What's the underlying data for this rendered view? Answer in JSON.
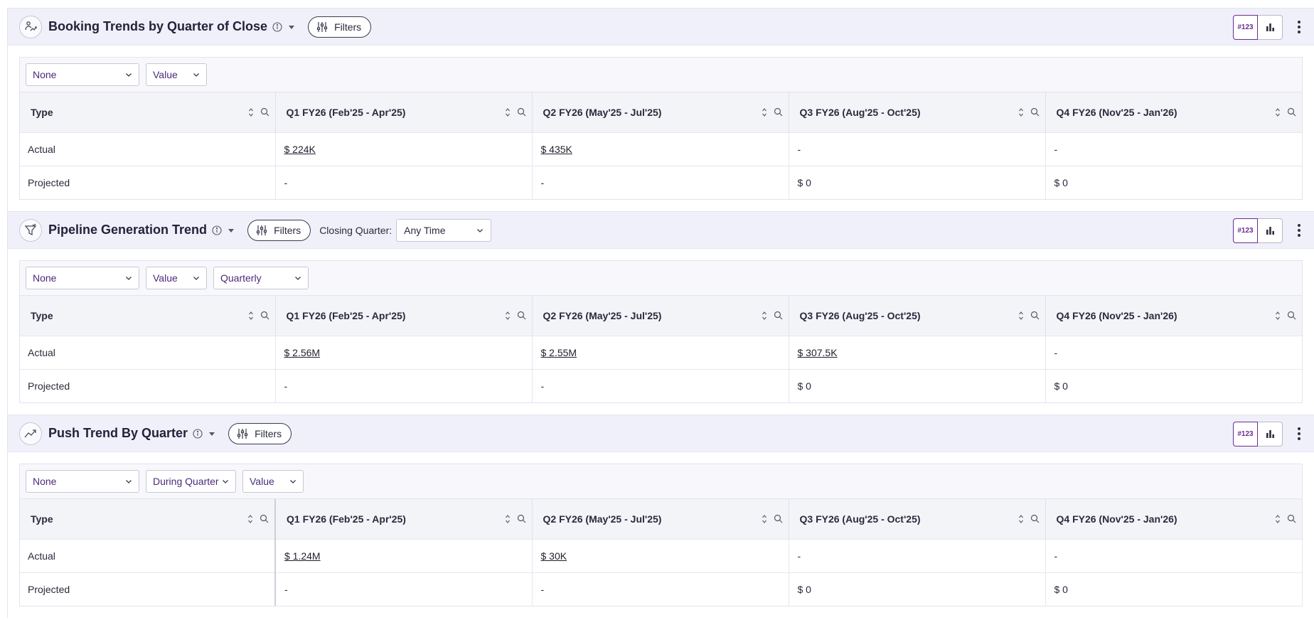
{
  "view_toggle": {
    "number_label": "#123"
  },
  "widgets": [
    {
      "title": "Booking Trends by Quarter of Close",
      "filters_label": "Filters",
      "controls": [
        "None",
        "Value"
      ],
      "columns": [
        "Type",
        "Q1 FY26 (Feb'25 - Apr'25)",
        "Q2 FY26 (May'25 - Jul'25)",
        "Q3 FY26 (Aug'25 - Oct'25)",
        "Q4 FY26 (Nov'25 - Jan'26)"
      ],
      "rows": [
        {
          "type": "Actual",
          "q1": "$ 224K",
          "q2": "$ 435K",
          "q3": "-",
          "q4": "-"
        },
        {
          "type": "Projected",
          "q1": "-",
          "q2": "-",
          "q3": "$ 0",
          "q4": "$ 0"
        }
      ]
    },
    {
      "title": "Pipeline Generation Trend",
      "filters_label": "Filters",
      "closing_quarter_label": "Closing Quarter:",
      "closing_quarter_value": "Any Time",
      "controls": [
        "None",
        "Value",
        "Quarterly"
      ],
      "columns": [
        "Type",
        "Q1 FY26 (Feb'25 - Apr'25)",
        "Q2 FY26 (May'25 - Jul'25)",
        "Q3 FY26 (Aug'25 - Oct'25)",
        "Q4 FY26 (Nov'25 - Jan'26)"
      ],
      "rows": [
        {
          "type": "Actual",
          "q1": "$ 2.56M",
          "q2": "$ 2.55M",
          "q3": "$ 307.5K",
          "q4": "-"
        },
        {
          "type": "Projected",
          "q1": "-",
          "q2": "-",
          "q3": "$ 0",
          "q4": "$ 0"
        }
      ]
    },
    {
      "title": "Push Trend By Quarter",
      "filters_label": "Filters",
      "controls": [
        "None",
        "During Quarter",
        "Value"
      ],
      "columns": [
        "Type",
        "Q1 FY26 (Feb'25 - Apr'25)",
        "Q2 FY26 (May'25 - Jul'25)",
        "Q3 FY26 (Aug'25 - Oct'25)",
        "Q4 FY26 (Nov'25 - Jan'26)"
      ],
      "rows": [
        {
          "type": "Actual",
          "q1": "$ 1.24M",
          "q2": "$ 30K",
          "q3": "-",
          "q4": "-"
        },
        {
          "type": "Projected",
          "q1": "-",
          "q2": "-",
          "q3": "$ 0",
          "q4": "$ 0"
        }
      ]
    }
  ],
  "colors": {
    "accent": "#6a2c91",
    "header_bg": "#f0f0fa",
    "table_header_bg": "#f3f4f8"
  }
}
